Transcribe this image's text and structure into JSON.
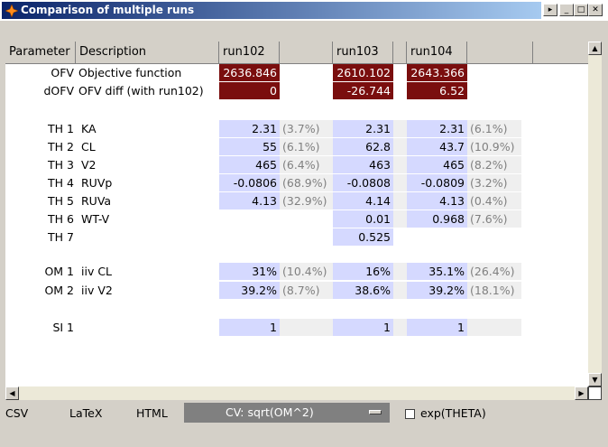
{
  "window": {
    "title": "Comparison of multiple runs",
    "buttons": {
      "pin": "▸",
      "minimize": "_",
      "maximize": "□",
      "close": "✕"
    }
  },
  "table": {
    "headers": {
      "parameter": "Parameter",
      "description": "Description",
      "runs": [
        "run102",
        "run103",
        "run104"
      ]
    },
    "ofv": {
      "label": "OFV",
      "description": "Objective function",
      "values": [
        "2636.846",
        "2610.102",
        "2643.366"
      ]
    },
    "dofv": {
      "label": "dOFV",
      "description": "OFV diff (with run102)",
      "values": [
        "0",
        "-26.744",
        "6.52"
      ]
    },
    "theta": [
      {
        "label": "TH 1",
        "description": "KA",
        "values": [
          "2.31",
          "2.31",
          "2.31"
        ],
        "cv": [
          "(3.7%)",
          "",
          "(6.1%)"
        ]
      },
      {
        "label": "TH 2",
        "description": "CL",
        "values": [
          "55",
          "62.8",
          "43.7"
        ],
        "cv": [
          "(6.1%)",
          "",
          "(10.9%)"
        ]
      },
      {
        "label": "TH 3",
        "description": "V2",
        "values": [
          "465",
          "463",
          "465"
        ],
        "cv": [
          "(6.4%)",
          "",
          "(8.2%)"
        ]
      },
      {
        "label": "TH 4",
        "description": "RUVp",
        "values": [
          "-0.0806",
          "-0.0808",
          "-0.0809"
        ],
        "cv": [
          "(68.9%)",
          "",
          "(3.2%)"
        ]
      },
      {
        "label": "TH 5",
        "description": "RUVa",
        "values": [
          "4.13",
          "4.14",
          "4.13"
        ],
        "cv": [
          "(32.9%)",
          "",
          "(0.4%)"
        ]
      },
      {
        "label": "TH 6",
        "description": "WT-V",
        "values": [
          "",
          "0.01",
          "0.968"
        ],
        "cv": [
          "",
          "",
          "(7.6%)"
        ]
      },
      {
        "label": "TH 7",
        "description": "",
        "values": [
          "",
          "0.525",
          ""
        ],
        "cv": [
          "",
          "",
          ""
        ]
      }
    ],
    "omega": [
      {
        "label": "OM 1",
        "description": "iiv CL",
        "values": [
          "31%",
          "16%",
          "35.1%"
        ],
        "cv": [
          "(10.4%)",
          "",
          "(26.4%)"
        ]
      },
      {
        "label": "OM 2",
        "description": "iiv V2",
        "values": [
          "39.2%",
          "38.6%",
          "39.2%"
        ],
        "cv": [
          "(8.7%)",
          "",
          "(18.1%)"
        ]
      }
    ],
    "sigma": [
      {
        "label": "SI 1",
        "description": "",
        "values": [
          "1",
          "1",
          "1"
        ],
        "cv": [
          "",
          "",
          ""
        ]
      }
    ]
  },
  "bottom": {
    "csv": "CSV",
    "latex": "LaTeX",
    "html": "HTML",
    "cv_select": "CV: sqrt(OM^2)",
    "exp_theta": "exp(THETA)"
  },
  "colors": {
    "ofv_bg": "#7a0e0e",
    "estimate_bg": "#d5d9ff",
    "cv_bg": "#efefef"
  }
}
